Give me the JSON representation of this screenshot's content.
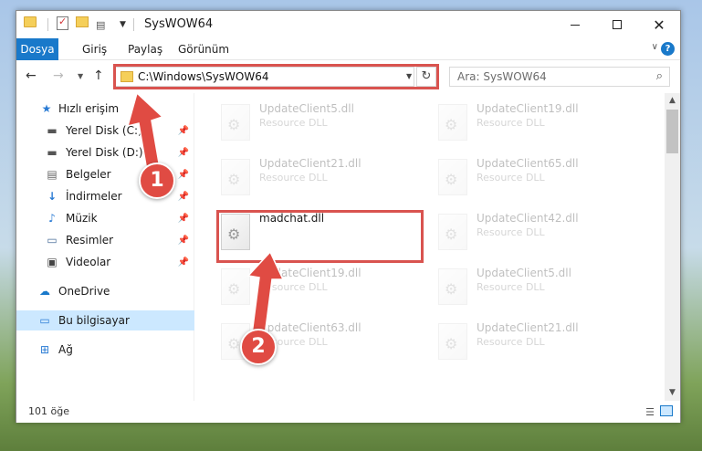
{
  "window": {
    "title": "SysWOW64"
  },
  "ribbon": {
    "tabs": [
      "Dosya",
      "Giriş",
      "Paylaş",
      "Görünüm"
    ]
  },
  "address": {
    "path": "C:\\Windows\\SysWOW64"
  },
  "search": {
    "placeholder": "Ara: SysWOW64"
  },
  "sidebar": {
    "items": [
      {
        "label": "Hızlı erişim",
        "icon": "star-icon"
      },
      {
        "label": "Yerel Disk (C:)",
        "icon": "drive-icon",
        "pinned": true
      },
      {
        "label": "Yerel Disk (D:)",
        "icon": "drive-icon",
        "pinned": true
      },
      {
        "label": "Belgeler",
        "icon": "document-icon",
        "pinned": true
      },
      {
        "label": "İndirmeler",
        "icon": "download-icon",
        "pinned": true
      },
      {
        "label": "Müzik",
        "icon": "music-icon",
        "pinned": true
      },
      {
        "label": "Resimler",
        "icon": "pictures-icon",
        "pinned": true
      },
      {
        "label": "Videolar",
        "icon": "video-icon",
        "pinned": true
      },
      {
        "label": "OneDrive",
        "icon": "cloud-icon"
      },
      {
        "label": "Bu bilgisayar",
        "icon": "computer-icon",
        "selected": true
      },
      {
        "label": "Ağ",
        "icon": "network-icon"
      }
    ]
  },
  "files": {
    "left": [
      {
        "name": "UpdateClient5.dll",
        "desc": "Resource DLL",
        "faded": true
      },
      {
        "name": "UpdateClient21.dll",
        "desc": "Resource DLL",
        "faded": true
      },
      {
        "name": "madchat.dll",
        "desc": "",
        "faded": false
      },
      {
        "name": "UpdateClient19.dll",
        "desc": "Resource DLL",
        "faded": true
      },
      {
        "name": "UpdateClient63.dll",
        "desc": "Resource DLL",
        "faded": true
      }
    ],
    "right": [
      {
        "name": "UpdateClient19.dll",
        "desc": "Resource DLL",
        "faded": true
      },
      {
        "name": "UpdateClient65.dll",
        "desc": "Resource DLL",
        "faded": true
      },
      {
        "name": "UpdateClient42.dll",
        "desc": "Resource DLL",
        "faded": true
      },
      {
        "name": "UpdateClient5.dll",
        "desc": "Resource DLL",
        "faded": true
      },
      {
        "name": "UpdateClient21.dll",
        "desc": "Resource DLL",
        "faded": true
      }
    ]
  },
  "status": {
    "item_count": "101 öğe"
  },
  "annotations": {
    "step1": "1",
    "step2": "2",
    "color": "#e04b43"
  }
}
